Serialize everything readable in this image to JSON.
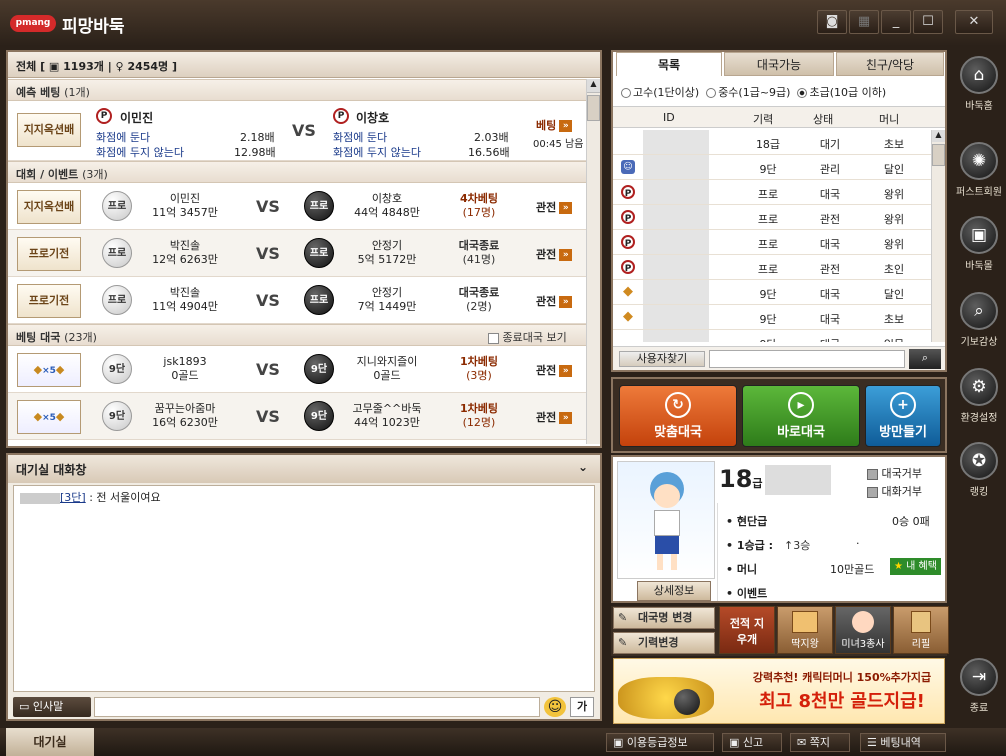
{
  "app": {
    "logo": "pmang",
    "title": "피망바둑"
  },
  "winbtns": [
    "◙",
    "▦",
    "_",
    "☐",
    "✕"
  ],
  "lobby": {
    "header": "전체 [ ▣ 1193개 | ♀ 2454명 ]",
    "predict": {
      "section": "예측 베팅",
      "count": "(1개)",
      "tag": "지지옥션배",
      "p1": {
        "name": "이민진",
        "line1": "화점에 둔다",
        "v1": "2.18배",
        "line2": "화점에 두지 않는다",
        "v2": "12.98배"
      },
      "vs": "VS",
      "p2": {
        "name": "이창호",
        "line1": "화점에 둔다",
        "v1": "2.03배",
        "line2": "화점에 두지 않는다",
        "v2": "16.56배"
      },
      "bet": "베팅",
      "time": "00:45 남음"
    },
    "events": {
      "section": "대회 / 이벤트",
      "count": "(3개)",
      "rows": [
        {
          "tag": "지지옥션배",
          "ws": "프로",
          "wname": "이민진",
          "wsub": "11억 3457만",
          "vs": "VS",
          "bs": "프로",
          "bname": "이창호",
          "bsub": "44억 4848만",
          "st1": "4차베팅",
          "st2": "(17명)",
          "watch": "관전"
        },
        {
          "tag": "프로기전",
          "ws": "프로",
          "wname": "박진솔",
          "wsub": "12억 6263만",
          "vs": "VS",
          "bs": "프로",
          "bname": "안정기",
          "bsub": "5억 5172만",
          "st1": "대국종료",
          "st2": "(41명)",
          "watch": "관전"
        },
        {
          "tag": "프로기전",
          "ws": "프로",
          "wname": "박진솔",
          "wsub": "11억 4904만",
          "vs": "VS",
          "bs": "프로",
          "bname": "안정기",
          "bsub": "7억 1449만",
          "st1": "대국종료",
          "st2": "(2명)",
          "watch": "관전"
        }
      ]
    },
    "betting": {
      "section": "베팅 대국",
      "count": "(23개)",
      "checkbox": "종료대국 보기",
      "rows": [
        {
          "ws": "9단",
          "wname": "jsk1893",
          "wsub": "0골드",
          "vs": "VS",
          "bs": "9단",
          "bname": "지니와지즐이",
          "bsub": "0골드",
          "st1": "1차베팅",
          "st2": "(3명)",
          "watch": "관전"
        },
        {
          "ws": "9단",
          "wname": "꿈꾸는아줌마",
          "wsub": "16억 6230만",
          "vs": "VS",
          "bs": "9단",
          "bname": "고무줄^^바둑",
          "bsub": "44억 1023만",
          "st1": "1차베팅",
          "st2": "(12명)",
          "watch": "관전"
        }
      ]
    }
  },
  "chat": {
    "title": "대기실 대화창",
    "messages": [
      {
        "rank": "[3단]",
        "text": " : 전 서울이여요"
      }
    ],
    "greet": "인사말",
    "emoji": "☺",
    "font": "가"
  },
  "bottom": {
    "tab": "대기실",
    "buttons": [
      "이용등급정보",
      "신고",
      "쪽지",
      "베팅내역"
    ]
  },
  "users": {
    "tabs": [
      "목록",
      "대국가능",
      "친구/악당"
    ],
    "filters": [
      "고수(1단이상)",
      "중수(1급~9급)",
      "초급(10급 이하)"
    ],
    "selected_filter": 2,
    "columns": [
      "ID",
      "기력",
      "상태",
      "머니"
    ],
    "rows": [
      {
        "icon": "",
        "rank": "18급",
        "state": "대기",
        "money": "초보"
      },
      {
        "icon": "admin",
        "rank": "9단",
        "state": "관리",
        "money": "달인"
      },
      {
        "icon": "P",
        "rank": "프로",
        "state": "대국",
        "money": "왕위"
      },
      {
        "icon": "P",
        "rank": "프로",
        "state": "관전",
        "money": "왕위"
      },
      {
        "icon": "P",
        "rank": "프로",
        "state": "대국",
        "money": "왕위"
      },
      {
        "icon": "P",
        "rank": "프로",
        "state": "관전",
        "money": "초인"
      },
      {
        "icon": "diamond",
        "rank": "9단",
        "state": "대국",
        "money": "달인"
      },
      {
        "icon": "diamond",
        "rank": "9단",
        "state": "대국",
        "money": "초보"
      },
      {
        "icon": "",
        "rank": "9단",
        "state": "대국",
        "money": "입문"
      }
    ],
    "search_label": "사용자찾기"
  },
  "actions": [
    {
      "label": "맞춤대국",
      "color": "#d9541c"
    },
    {
      "label": "바로대국",
      "color": "#3f9a2a"
    },
    {
      "label": "방만들기",
      "color": "#1a78b4"
    }
  ],
  "profile": {
    "rank": "18",
    "rank_unit": "급",
    "refuse_game": "대국거부",
    "refuse_chat": "대화거부",
    "stats": [
      {
        "label": "현단급",
        "value": "0승 0패"
      },
      {
        "label": "1승급",
        "value": "↑3승",
        "extra": "·"
      },
      {
        "label": "머니",
        "value": "10만골드"
      },
      {
        "label": "이벤트",
        "value": ""
      }
    ],
    "benefit": "내 혜택",
    "detail": "상세정보"
  },
  "tools": {
    "rename": "대국명 변경",
    "rankchange": "기력변경",
    "clear": "전적 지우개",
    "tiles": [
      "딱지왕",
      "미녀3총사",
      "리필"
    ]
  },
  "banner": {
    "line1": "강력추천! 캐릭터머니 150%추가지급",
    "line2": "최고 8천만 골드지급!"
  },
  "sidebar": [
    {
      "label": "바둑홈",
      "icon": "home"
    },
    {
      "label": "퍼스트회원",
      "icon": "fan"
    },
    {
      "label": "바둑몰",
      "icon": "gift"
    },
    {
      "label": "기보감상",
      "icon": "search"
    },
    {
      "label": "환경설정",
      "icon": "gear"
    },
    {
      "label": "랭킹",
      "icon": "medal"
    },
    {
      "label": "종료",
      "icon": "exit"
    }
  ]
}
